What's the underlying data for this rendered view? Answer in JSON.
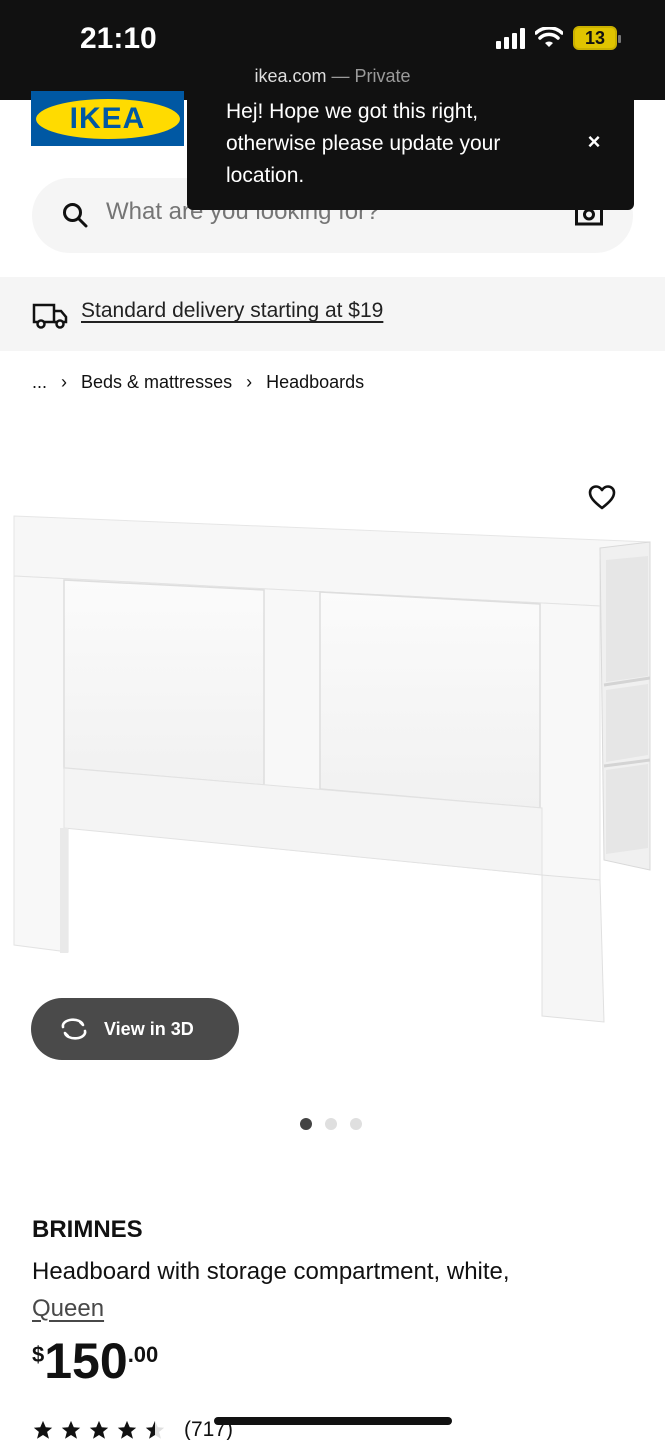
{
  "status_bar": {
    "time": "21:10",
    "battery": "13",
    "url": "ikea.com",
    "url_sep": " — ",
    "private": "Private"
  },
  "header": {
    "logo_text": "IKEA"
  },
  "toast": {
    "message": "Hej! Hope we got this right, otherwise please update your location.",
    "close_label": "×"
  },
  "search": {
    "placeholder": "What are you looking for?"
  },
  "delivery": {
    "label": "Standard delivery starting at $19"
  },
  "breadcrumb": {
    "ellipsis": "...",
    "items": [
      "Beds & mattresses",
      "Headboards"
    ],
    "separator": "›"
  },
  "gallery": {
    "view3d_label": "View in 3D",
    "total_images": 3,
    "active_index": 0
  },
  "product": {
    "name": "BRIMNES",
    "description": "Headboard with storage compartment, white,",
    "size": "Queen",
    "price_currency": "$",
    "price_integer": "150",
    "price_decimal": ".00",
    "rating": 4.5,
    "review_count": "(717)"
  },
  "colors": {
    "brand_blue": "#0058a3",
    "brand_yellow": "#ffdb00",
    "status_bar": "#111111"
  }
}
